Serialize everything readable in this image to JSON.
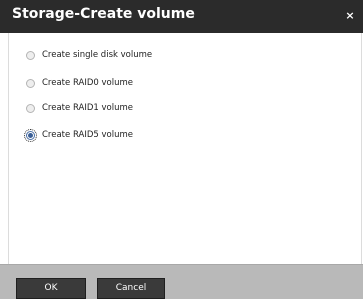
{
  "dialog": {
    "title": "Storage-Create volume",
    "close_glyph": "×"
  },
  "options": [
    {
      "label": "Create single disk volume",
      "checked": false
    },
    {
      "label": "Create RAID0 volume",
      "checked": false
    },
    {
      "label": "Create RAID1 volume",
      "checked": false
    },
    {
      "label": "Create RAID5 volume",
      "checked": true
    }
  ],
  "footer": {
    "ok_label": "OK",
    "cancel_label": "Cancel"
  },
  "colors": {
    "titlebar_bg": "#2b2b2b",
    "footer_bg": "#b9b9b9",
    "button_bg": "#3a3a3a",
    "radio_selected": "#3b5f96"
  },
  "icons": {
    "close": "close-icon",
    "radio": "radio-button-icon"
  }
}
